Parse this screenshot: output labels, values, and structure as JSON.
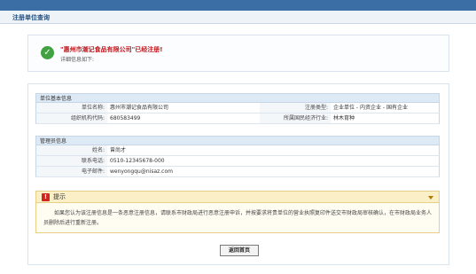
{
  "page": {
    "title": "注册单位查询"
  },
  "success": {
    "message": "\"惠州市潮记食品有限公司\"已经注册!",
    "sub": "详细信息如下:"
  },
  "unit_section": {
    "title": "单位基本信息",
    "rows": [
      {
        "label1": "单位名称:",
        "value1": "惠州市潮记食品有限公司",
        "label2": "注册类型:",
        "value2": "企业单位 - 内资企业 - 国有企业"
      },
      {
        "label1": "组织机构代码:",
        "value1": "680583499",
        "label2": "所属国民经济行业:",
        "value2": "林木育种"
      }
    ]
  },
  "admin_section": {
    "title": "管理员信息",
    "rows": [
      {
        "label": "姓名:",
        "value": "曾尚才"
      },
      {
        "label": "联系电话:",
        "value": "0510-12345678-000"
      },
      {
        "label": "电子邮件:",
        "value": "wenyongqu@nisaz.com"
      }
    ]
  },
  "tip": {
    "title": "提示",
    "body": "如果您认为该注册信息是一条恶意注册信息，请联系市财政局进行恶意注册申诉，并按要求将贵单位的营业执照复印件送交市财政局审核确认，在市财政局业务人员删除后进行重新注册。"
  },
  "buttons": {
    "back": "返回首页"
  }
}
